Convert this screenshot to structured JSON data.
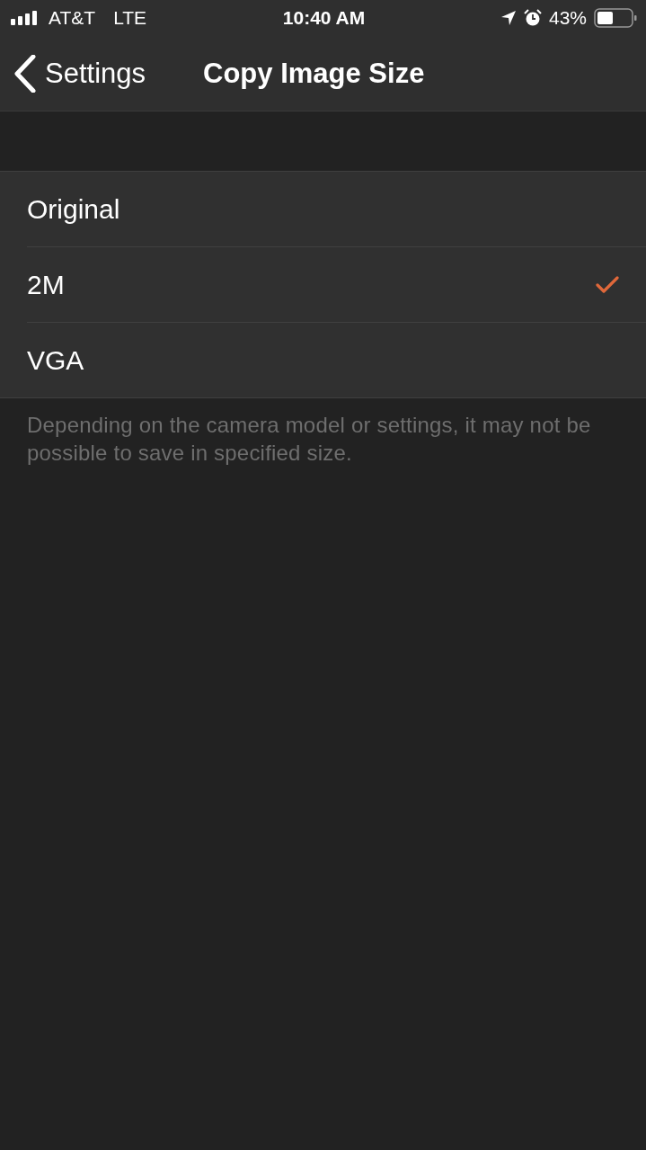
{
  "status_bar": {
    "carrier": "AT&T",
    "network": "LTE",
    "time": "10:40 AM",
    "battery_percent": "43%"
  },
  "nav": {
    "back": "Settings",
    "title": "Copy Image Size"
  },
  "options": [
    {
      "label": "Original",
      "selected": false
    },
    {
      "label": "2M",
      "selected": true
    },
    {
      "label": "VGA",
      "selected": false
    }
  ],
  "footer": "Depending on the camera model or settings, it may not be possible to save in specified size."
}
